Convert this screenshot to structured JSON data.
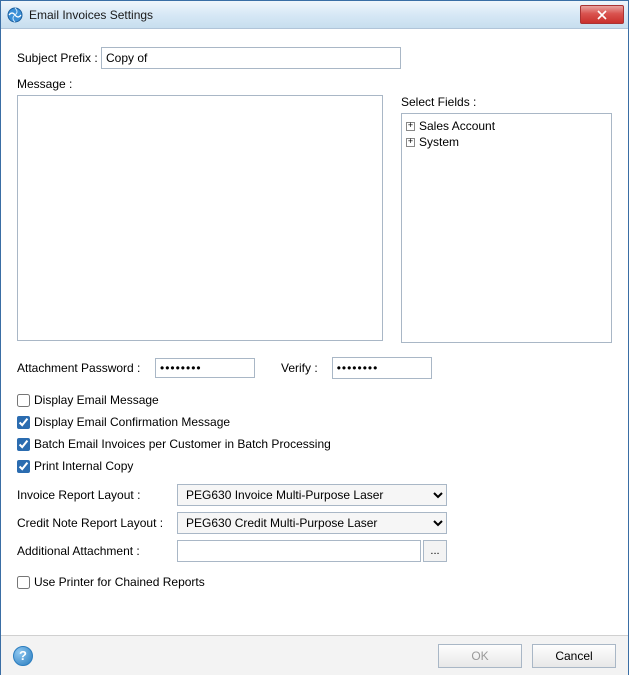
{
  "window": {
    "title": "Email Invoices Settings"
  },
  "labels": {
    "subject_prefix": "Subject Prefix :",
    "message": "Message :",
    "select_fields": "Select Fields :",
    "attachment_password": "Attachment Password :",
    "verify": "Verify :",
    "invoice_layout": "Invoice Report Layout :",
    "credit_layout": "Credit Note Report Layout :",
    "additional_attachment": "Additional Attachment :"
  },
  "subject_prefix_value": "Copy of",
  "message_value": "",
  "tree_items": [
    "Sales Account",
    "System"
  ],
  "attachment_password_value": "********",
  "verify_value": "********",
  "checkboxes": {
    "display_email_message": {
      "label": "Display Email Message",
      "checked": false
    },
    "display_email_confirmation": {
      "label": "Display Email Confirmation Message",
      "checked": true
    },
    "batch_email_invoices": {
      "label": "Batch Email Invoices per Customer in Batch Processing",
      "checked": true
    },
    "print_internal_copy": {
      "label": "Print Internal Copy",
      "checked": true
    },
    "use_printer_chained": {
      "label": "Use Printer for Chained Reports",
      "checked": false
    }
  },
  "invoice_layout_value": "PEG630 Invoice Multi-Purpose Laser",
  "credit_layout_value": "PEG630 Credit Multi-Purpose Laser",
  "additional_attachment_value": "",
  "browse_label": "...",
  "buttons": {
    "ok": "OK",
    "cancel": "Cancel",
    "help": "?"
  }
}
